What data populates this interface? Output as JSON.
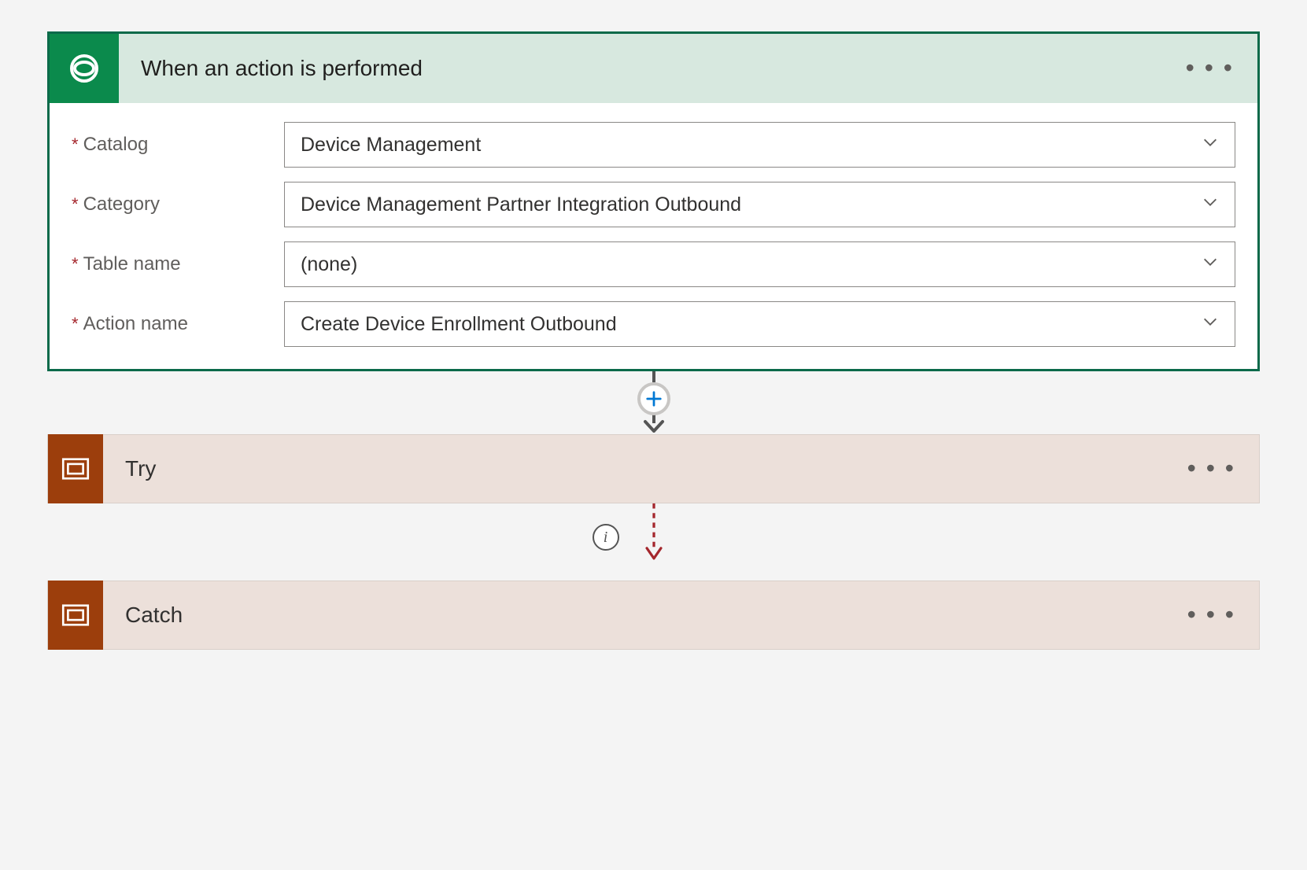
{
  "trigger": {
    "title": "When an action is performed",
    "icon": "dataverse-swirl-icon",
    "fields": [
      {
        "label": "Catalog",
        "value": "Device Management"
      },
      {
        "label": "Category",
        "value": "Device Management Partner Integration Outbound"
      },
      {
        "label": "Table name",
        "value": "(none)"
      },
      {
        "label": "Action name",
        "value": "Create Device Enrollment Outbound"
      }
    ]
  },
  "steps": [
    {
      "title": "Try"
    },
    {
      "title": "Catch"
    }
  ],
  "glyphs": {
    "ellipsis": "• • •",
    "plus": "+",
    "info": "i"
  }
}
